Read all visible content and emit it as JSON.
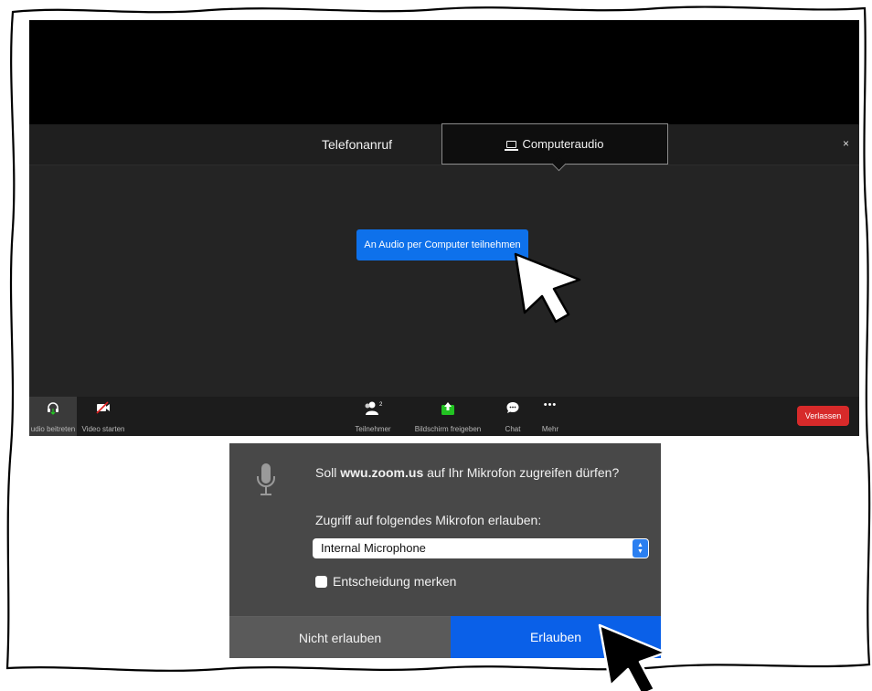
{
  "zoom": {
    "tabs": {
      "phone_label": "Telefonanruf",
      "computer_label": "Computeraudio"
    },
    "close_label": "×",
    "join_button_label": "An Audio per Computer teilnehmen",
    "toolbar": {
      "audio_label": "udio beitreten",
      "video_label": "Video starten",
      "participants_label": "Teilnehmer",
      "participants_count": "2",
      "share_label": "Bildschirm freigeben",
      "chat_label": "Chat",
      "more_label": "Mehr",
      "more_icon": "•••",
      "leave_label": "Verlassen"
    },
    "colors": {
      "join_blue": "#0e71eb",
      "leave_red": "#d72a2a",
      "share_green": "#22c322"
    }
  },
  "dialog": {
    "question_prefix": "Soll ",
    "site": "wwu.zoom.us",
    "question_suffix": " auf Ihr Mikrofon zugreifen dürfen?",
    "allow_label": "Zugriff auf folgendes Mikrofon erlauben:",
    "microphone_selected": "Internal Microphone",
    "remember_label": "Entscheidung merken",
    "deny_label": "Nicht erlauben",
    "allow_button_label": "Erlauben",
    "colors": {
      "allow_blue": "#0a60e8"
    }
  }
}
